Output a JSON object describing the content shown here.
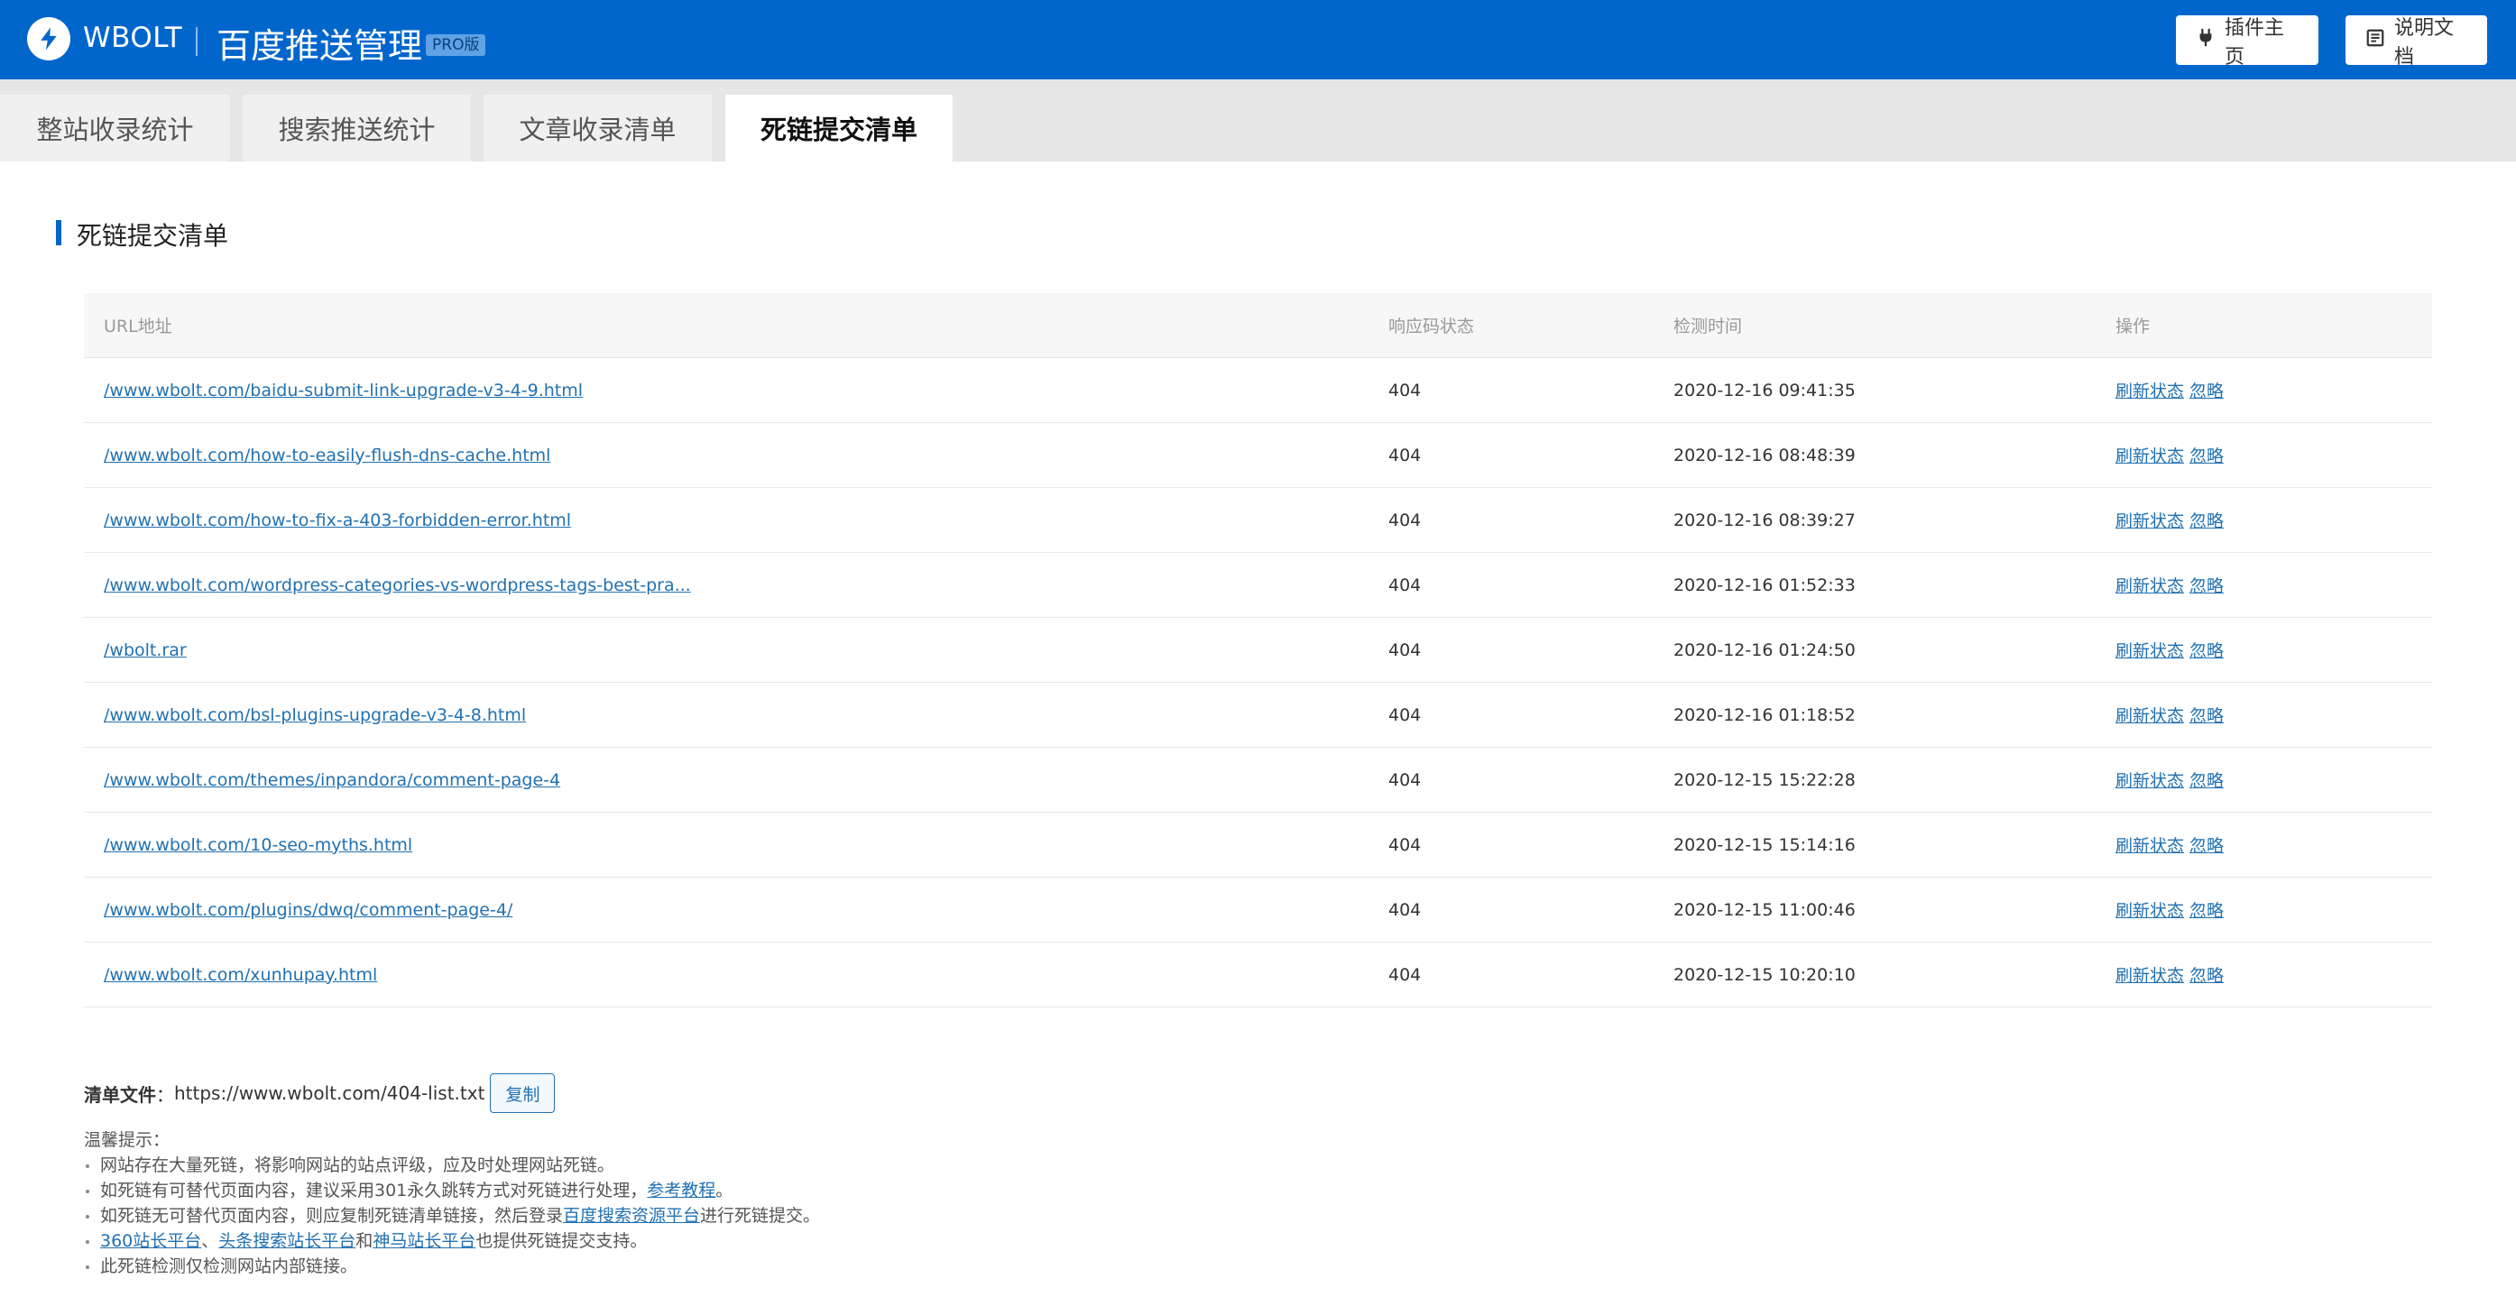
{
  "header": {
    "brand": "WBOLT",
    "title": "百度推送管理",
    "badge": "PRO版",
    "plugin_home": "插件主页",
    "docs": "说明文档"
  },
  "tabs": [
    {
      "label": "整站收录统计"
    },
    {
      "label": "搜索推送统计"
    },
    {
      "label": "文章收录清单"
    },
    {
      "label": "死链提交清单"
    }
  ],
  "section": {
    "title": "死链提交清单"
  },
  "table": {
    "columns": [
      "URL地址",
      "响应码状态",
      "检测时间",
      "操作"
    ],
    "ops": {
      "refresh": "刷新状态",
      "ignore": "忽略"
    },
    "rows": [
      {
        "url": "/www.wbolt.com/baidu-submit-link-upgrade-v3-4-9.html",
        "code": "404",
        "time": "2020-12-16 09:41:35"
      },
      {
        "url": "/www.wbolt.com/how-to-easily-flush-dns-cache.html",
        "code": "404",
        "time": "2020-12-16 08:48:39"
      },
      {
        "url": "/www.wbolt.com/how-to-fix-a-403-forbidden-error.html",
        "code": "404",
        "time": "2020-12-16 08:39:27"
      },
      {
        "url": "/www.wbolt.com/wordpress-categories-vs-wordpress-tags-best-pra...",
        "code": "404",
        "time": "2020-12-16 01:52:33"
      },
      {
        "url": "/wbolt.rar",
        "code": "404",
        "time": "2020-12-16 01:24:50"
      },
      {
        "url": "/www.wbolt.com/bsl-plugins-upgrade-v3-4-8.html",
        "code": "404",
        "time": "2020-12-16 01:18:52"
      },
      {
        "url": "/www.wbolt.com/themes/inpandora/comment-page-4",
        "code": "404",
        "time": "2020-12-15 15:22:28"
      },
      {
        "url": "/www.wbolt.com/10-seo-myths.html",
        "code": "404",
        "time": "2020-12-15 15:14:16"
      },
      {
        "url": "/www.wbolt.com/plugins/dwq/comment-page-4/",
        "code": "404",
        "time": "2020-12-15 11:00:46"
      },
      {
        "url": "/www.wbolt.com/xunhupay.html",
        "code": "404",
        "time": "2020-12-15 10:20:10"
      }
    ]
  },
  "listfile": {
    "label": "清单文件",
    "colon": "：",
    "url": "https://www.wbolt.com/404-list.txt",
    "copy": "复制"
  },
  "tips": {
    "title": "温馨提示：",
    "t1": "网站存在大量死链，将影响网站的站点评级，应及时处理网站死链。",
    "t2_pre": "如死链有可替代页面内容，建议采用301永久跳转方式对死链进行处理，",
    "t2_link": "参考教程",
    "t2_post": "。",
    "t3_pre": "如死链无可替代页面内容，则应复制死链清单链接，然后登录",
    "t3_link": "百度搜索资源平台",
    "t3_post": "进行死链提交。",
    "t4_link1": "360站长平台",
    "t4_sep1": "、",
    "t4_link2": "头条搜索站长平台",
    "t4_sep2": "和",
    "t4_link3": "神马站长平台",
    "t4_post": "也提供死链提交支持。",
    "t5": "此死链检测仅检测网站内部链接。"
  },
  "colors": {
    "brand_blue": "#0066cc",
    "link": "#2271b1"
  },
  "icons": [
    "wbolt-logo-icon",
    "plug-icon",
    "document-icon"
  ]
}
